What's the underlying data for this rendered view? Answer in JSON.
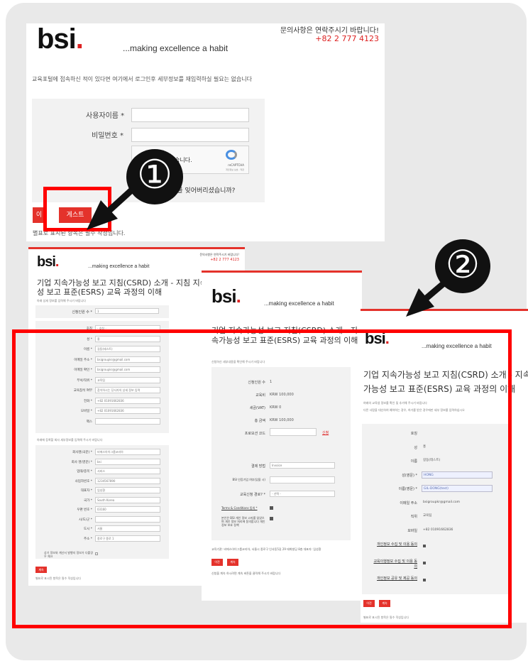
{
  "top": {
    "contact_text": "문의사항은 연락주시기 바랍니다!",
    "phone": "+82 2 777 4123",
    "logo_text": "bsi",
    "tagline": "...making excellence a habit",
    "intro": "교육포털에 접속하신 적이 있다면 여기에서 로그인후 세부정보를 재입력하실 필요는 없습니다",
    "username_label": "사용자이름 *",
    "password_label": "비밀번호 *",
    "captcha_text": "습니다.",
    "captcha_brand": "reCAPTCHA",
    "captcha_sub": "개인정보 보호 - 약관",
    "forgot_text": "호를 잊어버리셨습니까?",
    "login_btn": "이",
    "guest_btn": "게스트",
    "required_note": "별표로 표시된 항목은 필수 작성입니다."
  },
  "badges": {
    "one": "①",
    "two": "②"
  },
  "form1": {
    "contact": "문의사항은 연락주시기 바랍니다!",
    "phone": "+82 2 777 4123",
    "title": "기업 지속가능성 보고 지침(CSRD) 소개 - 지침 지속가능성 보고 표준(ESRS) 교육 과정의 이해",
    "intro": "아래 상세 정보를 입력해 주시기 바랍니다",
    "seats_label": "신청인원 수 *",
    "seats_value": "1",
    "fields": [
      {
        "label": "호칭",
        "value": "- 호칭 -"
      },
      {
        "label": "성 *",
        "value": "홍"
      },
      {
        "label": "이름 *",
        "value": "길동(테스트)"
      },
      {
        "label": "이메일 주소 *",
        "value": "bsigroupkr@gmail.com"
      },
      {
        "label": "이메일 확인 *",
        "value": "bsigroupkr@gmail.com"
      },
      {
        "label": "부서/직위 *",
        "value": "교육팀"
      },
      {
        "label": "교육참석 여부",
        "value": "참석하시는 당사자의 상세 정보 입력"
      },
      {
        "label": "전화 *",
        "value": "+82   01091662836"
      },
      {
        "label": "모바일 *",
        "value": "+82   01091662836"
      },
      {
        "label": "팩스",
        "value": ""
      }
    ],
    "company_note": "아래에 등록할 회사 세부정보를 입력해 주시기 바랍니다",
    "company_fields": [
      {
        "label": "회사명(국문) *",
        "value": "비에스아이그룹코리아"
      },
      {
        "label": "회사 명(영문) *",
        "value": "bsi"
      },
      {
        "label": "업태/종목 *",
        "value": "서비스"
      },
      {
        "label": "사업자번호 *",
        "value": "1234567890"
      },
      {
        "label": "대표자 *",
        "value": "임성환"
      },
      {
        "label": "국가 *",
        "value": "South Korea"
      },
      {
        "label": "우편 번호 *",
        "value": "03160"
      },
      {
        "label": "시/도/군 *",
        "value": ""
      },
      {
        "label": "도시 *",
        "value": "서울"
      },
      {
        "label": "주소 *",
        "value": "종로구 종로 1"
      }
    ],
    "same_as": "상기 정보와 계산서 발행지 정보가 다를경우 체크",
    "next_btn": "계속",
    "required_note": "별표로 표시된 항목은 필수 작성입니다"
  },
  "form2": {
    "title": "기업 지속가능성 보고 지침(CSRD) 소개 - 지속가능성 보고 표준(ESRS) 교육 과정의 이해",
    "intro": "신청하신 세부내용을 확인해 주시기 바랍니다",
    "rows": [
      {
        "label": "신청인원 수",
        "value": "1"
      },
      {
        "label": "교육비",
        "value": "KRW 100,000"
      },
      {
        "label": "세금(VAT)",
        "value": "KRW 0"
      },
      {
        "label": "총 금액",
        "value": "KRW 100,000"
      }
    ],
    "promo_label": "프로모션 코드",
    "promo_link": "신청",
    "pay_label": "결제 방법",
    "pay_value": "Invoice",
    "bsi_label": "BSI 인증기업 여부(있을 시)",
    "route_label": "교육신청 경로? *",
    "route_value": "- 선택 -",
    "terms": "Terms & Conditions 동의 *",
    "privacy": "본인은 BSI 개인 정보 고지를 읽었으며 개인 정보 처리에 동의합니다 개인 정보 보호 정책",
    "company_info": "교육기관: 비에스아이그룹코리아, 서울시 종로구 인사동5길 29 태화빌딩 8층 대표자: 임성환",
    "prev_btn": "이전",
    "next_btn": "계속",
    "note": "신청을 계속 하시려면 계속 버튼을 클릭해 주시기 바랍니다"
  },
  "form3": {
    "logo_text": "bsi",
    "tagline": "...making excellence a habit",
    "title": "기업 지속가능성 보고 지침(CSRD) 소개 - 지속가능성 보고 표준(ESRS) 교육 과정의 이해",
    "intro": "여래의 교육생 정보를 확인 및 추가해 주시기 바랍니다",
    "intro2": "다른 사람을 대신하여 예약하는 경우, 허가를 받은 경우에만 세부 정보를 입력하십시오",
    "fields": [
      {
        "label": "호칭",
        "value": ""
      },
      {
        "label": "성",
        "value": "홍"
      },
      {
        "label": "이름",
        "value": "길동(테스트)"
      },
      {
        "label": "성(영문) *",
        "value": "HONG"
      },
      {
        "label": "이름(영문) *",
        "value": "GIL-DONG(test)"
      },
      {
        "label": "이메일 주소",
        "value": "bsigroupkr@gmail.com"
      },
      {
        "label": "직위",
        "value": "교육팀"
      },
      {
        "label": "모바일",
        "value": "+82 01091662836"
      }
    ],
    "consents": [
      "개인정보 수집 및 이용 동의",
      "교육이행정보 수집 및 이용 동의",
      "개인정보 공유 및 제공 동의"
    ],
    "prev_btn": "이전",
    "next_btn": "계속",
    "note": "별표로 표시된 항목은 필수 작성입니다"
  },
  "colors": {
    "accent": "#e4322b",
    "highlight": "#ff0000"
  }
}
